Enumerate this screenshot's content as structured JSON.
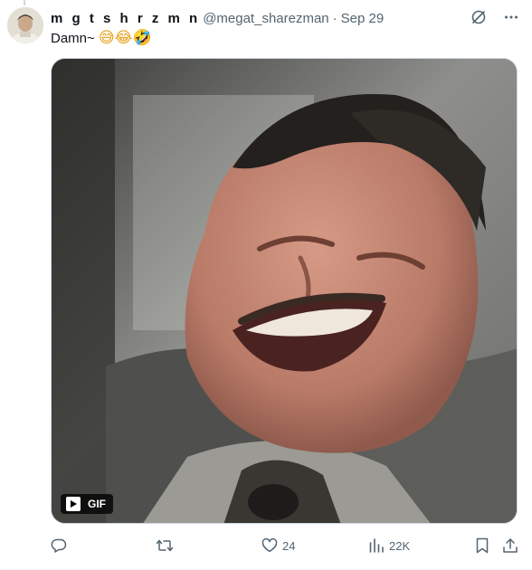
{
  "tweet": {
    "display_name": "m g t s h r z m n",
    "handle": "@megat_sharezman",
    "separator": "·",
    "time": "Sep 29",
    "text": "Damn~",
    "emojis": "😅😂🤣",
    "media": {
      "type": "animated-gif",
      "badge_label": "GIF"
    }
  },
  "actions": {
    "reply": {
      "icon": "reply-icon",
      "count": ""
    },
    "retweet": {
      "icon": "retweet-icon",
      "count": ""
    },
    "like": {
      "icon": "heart-icon",
      "count": "24"
    },
    "views": {
      "icon": "views-icon",
      "count": "22K"
    },
    "bookmark": {
      "icon": "bookmark-icon"
    },
    "share": {
      "icon": "share-icon"
    }
  },
  "header_icons": [
    "grok-icon",
    "more-icon"
  ],
  "colors": {
    "text_primary": "#0f1419",
    "text_secondary": "#536471",
    "border": "#cfd9de"
  }
}
